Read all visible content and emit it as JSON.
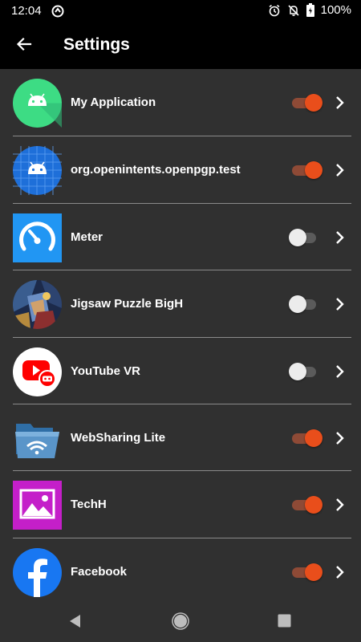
{
  "status_bar": {
    "time": "12:04",
    "icons": [
      "sync-icon",
      "alarm-icon",
      "notifications-off-icon",
      "battery-icon"
    ],
    "battery_percent": "100%"
  },
  "app_bar": {
    "title": "Settings",
    "back_icon": "arrow-back-icon"
  },
  "apps": [
    {
      "name": "My Application",
      "icon": "android-round-icon",
      "enabled": true
    },
    {
      "name": "org.openintents.openpgp.test",
      "icon": "android-grid-icon",
      "enabled": true
    },
    {
      "name": "Meter",
      "icon": "speedometer-icon",
      "enabled": false
    },
    {
      "name": "Jigsaw Puzzle BigH",
      "icon": "puzzle-art-icon",
      "enabled": false
    },
    {
      "name": "YouTube VR",
      "icon": "youtube-vr-icon",
      "enabled": false
    },
    {
      "name": "WebSharing Lite",
      "icon": "wifi-folder-icon",
      "enabled": true
    },
    {
      "name": "TechH",
      "icon": "image-gallery-icon",
      "enabled": true
    },
    {
      "name": "Facebook",
      "icon": "facebook-icon",
      "enabled": true
    }
  ],
  "colors": {
    "background": "#303030",
    "toggle_on": "#e94e1b",
    "toggle_off": "#ececec"
  },
  "nav_bar": {
    "icons": [
      "back-triangle-icon",
      "home-circle-icon",
      "recents-square-icon"
    ]
  }
}
